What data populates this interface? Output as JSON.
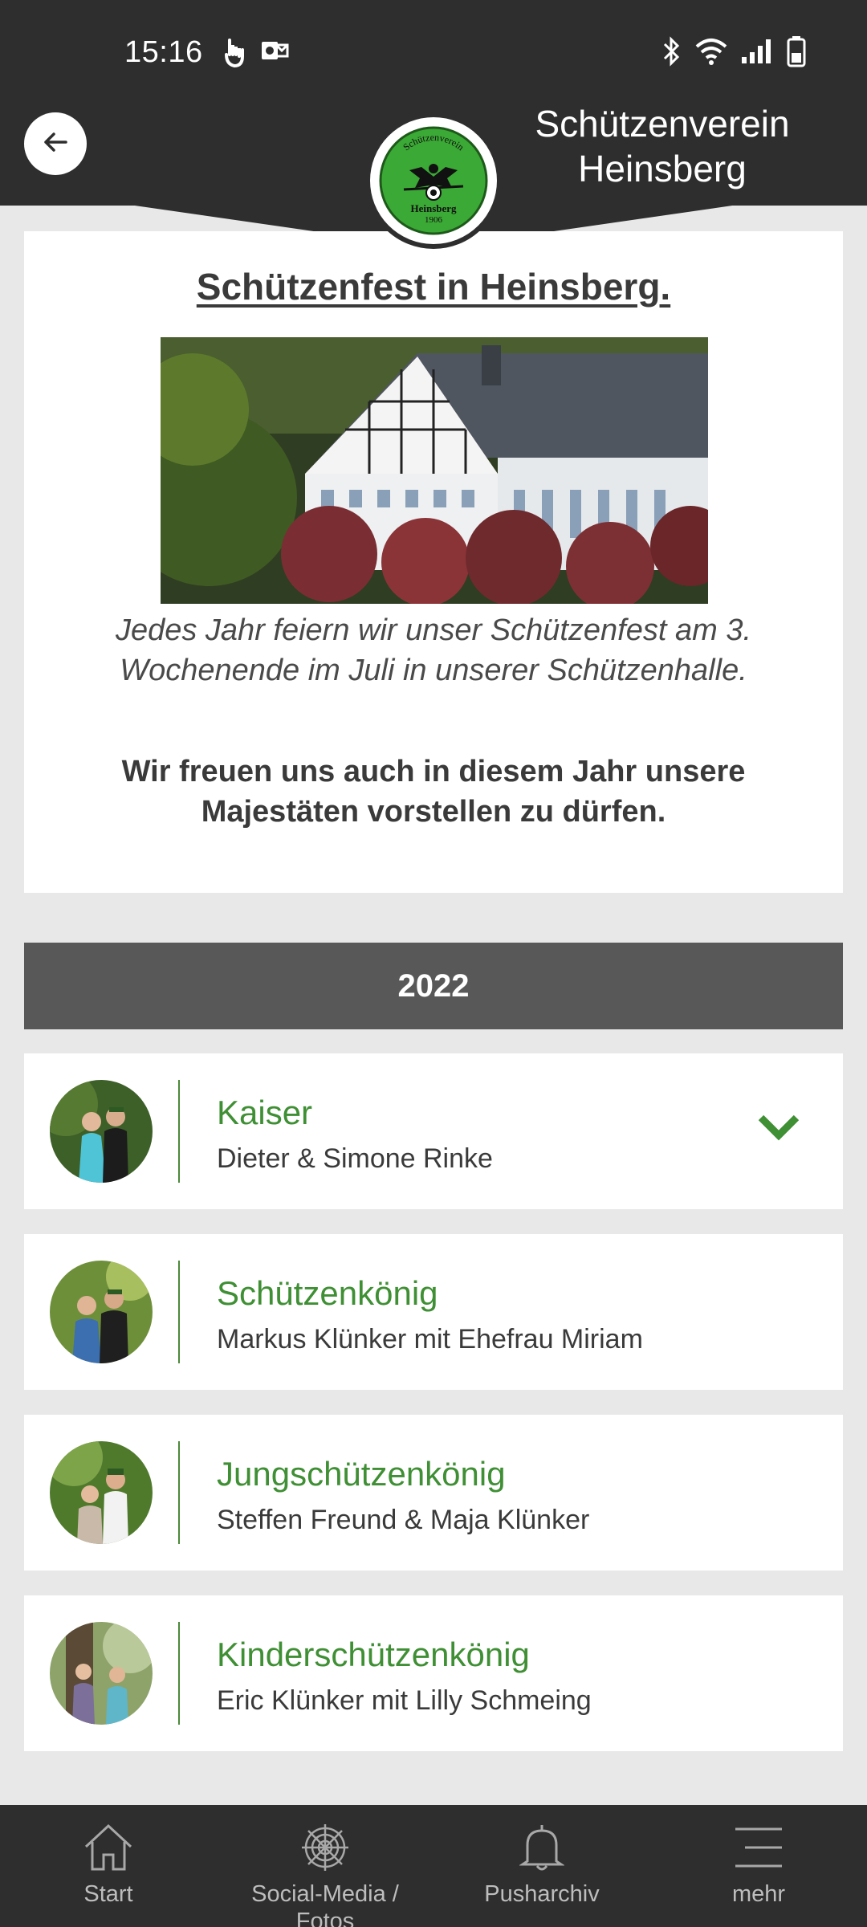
{
  "status_bar": {
    "time": "15:16",
    "left_icons": [
      "touch-icon",
      "outlook-icon"
    ],
    "right_icons": [
      "bluetooth-icon",
      "wifi-icon",
      "signal-icon",
      "battery-icon"
    ]
  },
  "header": {
    "title_line1": "Schützenverein",
    "title_line2": "Heinsberg",
    "logo_text_top": "Schützenverein",
    "logo_text_bottom": "Heinsberg",
    "logo_year": "1906",
    "back_icon": "arrow-left-icon"
  },
  "intro": {
    "title": "Schützenfest in Heinsberg.",
    "image_alt": "Schützenhalle",
    "text_italic": "Jedes Jahr feiern wir unser Schützenfest am 3. Wochenende im Juli in unserer Schützenhalle.",
    "text_bold": "Wir freuen uns auch in diesem Jahr unsere Majestäten vorstellen zu dürfen."
  },
  "year": "2022",
  "majesties": [
    {
      "title": "Kaiser",
      "names": "Dieter & Simone Rinke",
      "expanded_icon": "chevron-down-icon"
    },
    {
      "title": "Schützenkönig",
      "names": "Markus Klünker mit Ehefrau Miriam"
    },
    {
      "title": "Jungschützenkönig",
      "names": "Steffen Freund & Maja Klünker"
    },
    {
      "title": "Kinderschützenkönig",
      "names": "Eric Klünker mit Lilly Schmeing"
    }
  ],
  "bottom_nav": [
    {
      "label": "Start",
      "icon": "home-icon"
    },
    {
      "label": "Social-Media / Fotos",
      "icon": "web-icon"
    },
    {
      "label": "Pusharchiv",
      "icon": "bell-icon"
    },
    {
      "label": "mehr",
      "icon": "menu-icon"
    }
  ],
  "colors": {
    "header_bg": "#2e2e2e",
    "accent_green": "#3f8f34",
    "year_bar": "#585858",
    "page_bg": "#e8e8e8"
  }
}
